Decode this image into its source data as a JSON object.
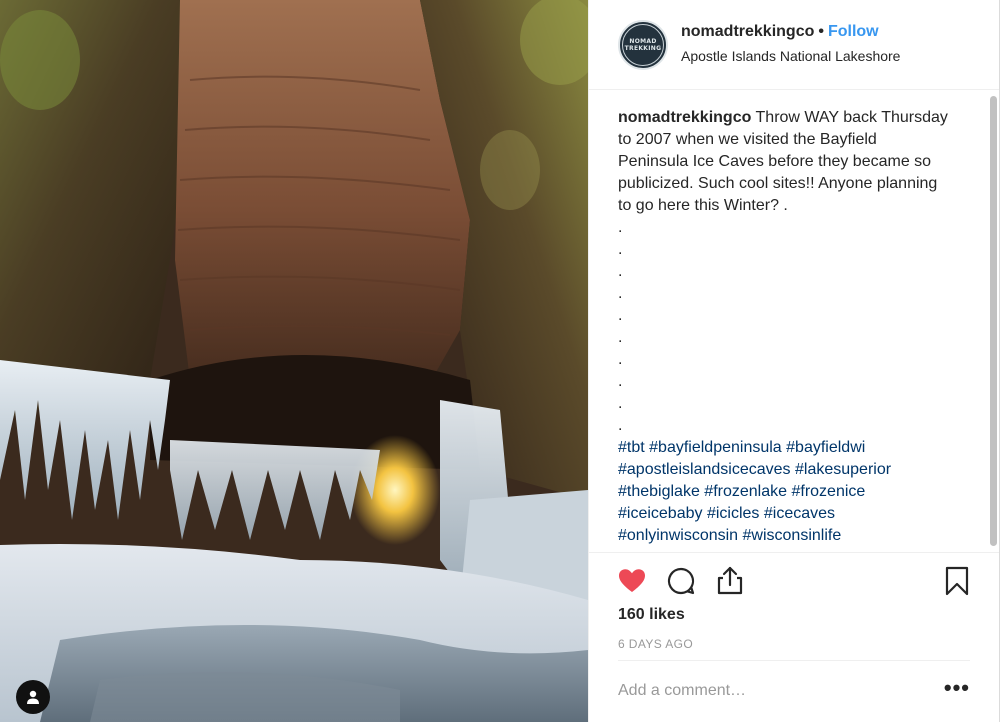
{
  "post": {
    "image_alt": "Ice caves with icicles and snow",
    "user_tag_icon": "user-icon"
  },
  "header": {
    "avatar_text": [
      "NOMAD",
      "TREKKING"
    ],
    "username": "nomadtrekkingco",
    "separator": "•",
    "follow_label": "Follow",
    "location": "Apostle Islands National Lakeshore"
  },
  "caption": {
    "username": "nomadtrekkingco",
    "lines": [
      "Throw WAY back Thursday",
      "to 2007 when we visited the Bayfield",
      "Peninsula Ice Caves before they became so",
      "publicized. Such cool sites!! Anyone planning",
      "to go here this Winter? ."
    ],
    "dots": [
      ".",
      ".",
      ".",
      ".",
      ".",
      ".",
      ".",
      ".",
      ".",
      "."
    ],
    "hashtag_lines": [
      [
        "#tbt",
        "#bayfieldpeninsula",
        "#bayfieldwi"
      ],
      [
        "#apostleislandsicecaves",
        "#lakesuperior"
      ],
      [
        "#thebiglake",
        "#frozenlake",
        "#frozenice"
      ],
      [
        "#iceicebaby",
        "#icicles",
        "#icecaves"
      ],
      [
        "#onlyinwisconsin",
        "#wisconsinlife"
      ]
    ]
  },
  "actions": {
    "like_icon": "heart-icon",
    "comment_icon": "comment-icon",
    "share_icon": "share-icon",
    "save_icon": "bookmark-icon",
    "liked": true,
    "like_color": "#ed4956"
  },
  "stats": {
    "likes": "160 likes",
    "time": "6 DAYS AGO"
  },
  "comment": {
    "placeholder": "Add a comment…",
    "more_label": "•••"
  },
  "colors": {
    "link": "#3897f0",
    "hashtag": "#003569",
    "muted": "#999999"
  }
}
